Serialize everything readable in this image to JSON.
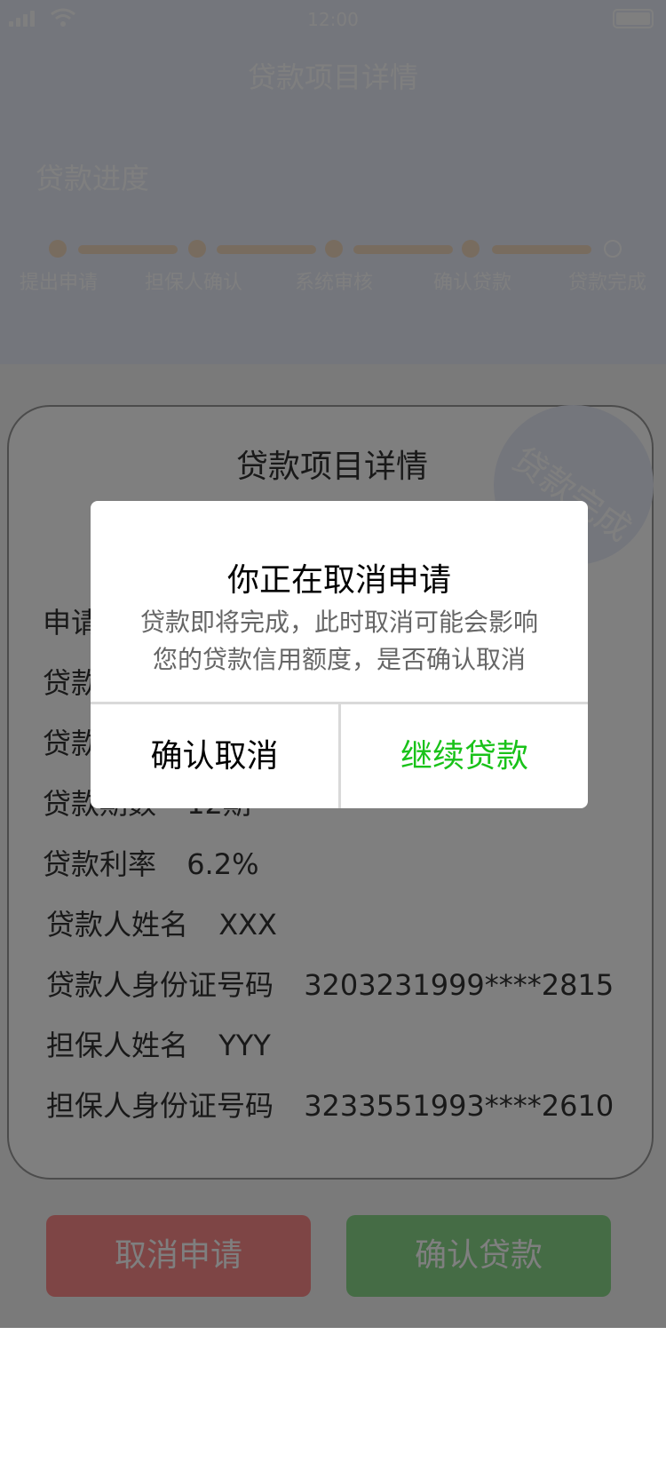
{
  "status_bar": {
    "time": "12:00"
  },
  "header": {
    "title": "贷款项目详情",
    "progress_label": "贷款进度"
  },
  "steps": [
    {
      "label": "提出申请",
      "done": true
    },
    {
      "label": "担保人确认",
      "done": true
    },
    {
      "label": "系统审核",
      "done": true
    },
    {
      "label": "确认贷款",
      "done": true
    },
    {
      "label": "贷款完成",
      "done": false
    }
  ],
  "card": {
    "title": "贷款项目详情",
    "stamp": "贷款完成",
    "rows": [
      {
        "label": "申请",
        "value": ""
      },
      {
        "label": "贷款",
        "value": ""
      },
      {
        "label": "贷款",
        "value": ""
      },
      {
        "label": "贷款期数",
        "value": "12期"
      },
      {
        "label": "贷款利率",
        "value": "6.2%"
      },
      {
        "label": "贷款人姓名",
        "value": "XXX"
      },
      {
        "label": "贷款人身份证号码",
        "value": "3203231999****2815"
      },
      {
        "label": "担保人姓名",
        "value": "YYY"
      },
      {
        "label": "担保人身份证号码",
        "value": "3233551993****2610"
      }
    ]
  },
  "actions": {
    "cancel_label": "取消申请",
    "confirm_label": "确认贷款"
  },
  "dialog": {
    "title": "你正在取消申请",
    "message_line1": "贷款即将完成，此时取消可能会影响",
    "message_line2": "您的贷款信用额度，是否确认取消",
    "confirm_cancel_label": "确认取消",
    "continue_label": "继续贷款"
  },
  "colors": {
    "accent_green": "#19c219",
    "cancel_red": "#fc8b8b",
    "confirm_green": "#8bd98b",
    "header_bg": "#e9ecf8",
    "step_color": "#f0d9bf"
  }
}
